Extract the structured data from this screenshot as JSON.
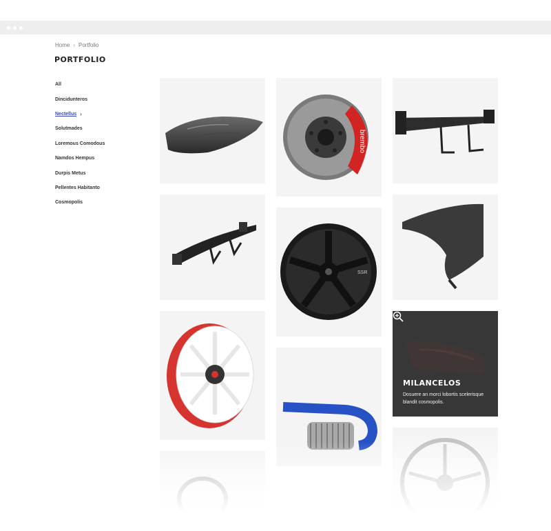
{
  "breadcrumb": {
    "home": "Home",
    "current": "Portfolio"
  },
  "page_title": "PORTFOLIO",
  "categories": [
    {
      "label": "All"
    },
    {
      "label": "Dincidunteros"
    },
    {
      "label": "Nectellus"
    },
    {
      "label": "Solutmades"
    },
    {
      "label": "Loremous Comodous"
    },
    {
      "label": "Namdos Hempus"
    },
    {
      "label": "Durpis Metus"
    },
    {
      "label": "Pellentes Habitanto"
    },
    {
      "label": "Cosmopolis"
    }
  ],
  "active_category": "Nectellus",
  "accent_color": "#3a4bb5",
  "portfolio_items": [
    {
      "icon": "car-hood-image"
    },
    {
      "icon": "brake-disc-image",
      "brand": "brembo"
    },
    {
      "icon": "rear-spoiler-image"
    },
    {
      "icon": "gt-wing-image"
    },
    {
      "icon": "black-wheel-image",
      "brand": "SSR"
    },
    {
      "icon": "fender-panel-image"
    },
    {
      "icon": "red-white-wheel-image"
    },
    {
      "icon": "air-intake-filter-image"
    },
    {
      "icon": "tail-light-image"
    },
    {
      "icon": "silver-wheel-image"
    },
    {
      "icon": "wheel-image"
    }
  ],
  "hover_item": {
    "title": "MILANCELOS",
    "description": "Dosuere an morci lobortis scelerisque blandit cosmopolis.",
    "icon": "zoom-in-icon"
  }
}
